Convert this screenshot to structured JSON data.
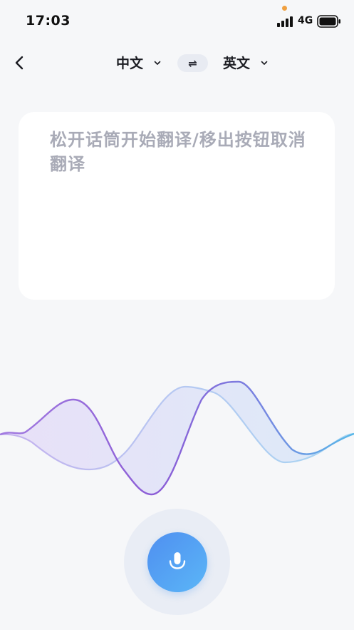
{
  "status_bar": {
    "time": "17:03",
    "network": "4G"
  },
  "header": {
    "source_language": "中文",
    "target_language": "英文",
    "swap_symbol": "⇌"
  },
  "card": {
    "hint": "松开话筒开始翻译/移出按钮取消翻译"
  },
  "icons": {
    "back": "chevron-left-icon",
    "dropdown": "chevron-down-icon",
    "swap": "swap-arrows-icon",
    "mic": "microphone-icon"
  },
  "colors": {
    "background": "#f6f7f9",
    "card": "#ffffff",
    "hint_text": "#a9abb7",
    "wave_purple": "#8b5cd6",
    "wave_blue": "#5aa9e6",
    "mic_gradient_start": "#4f8ff0",
    "mic_gradient_end": "#5bb6f7"
  }
}
